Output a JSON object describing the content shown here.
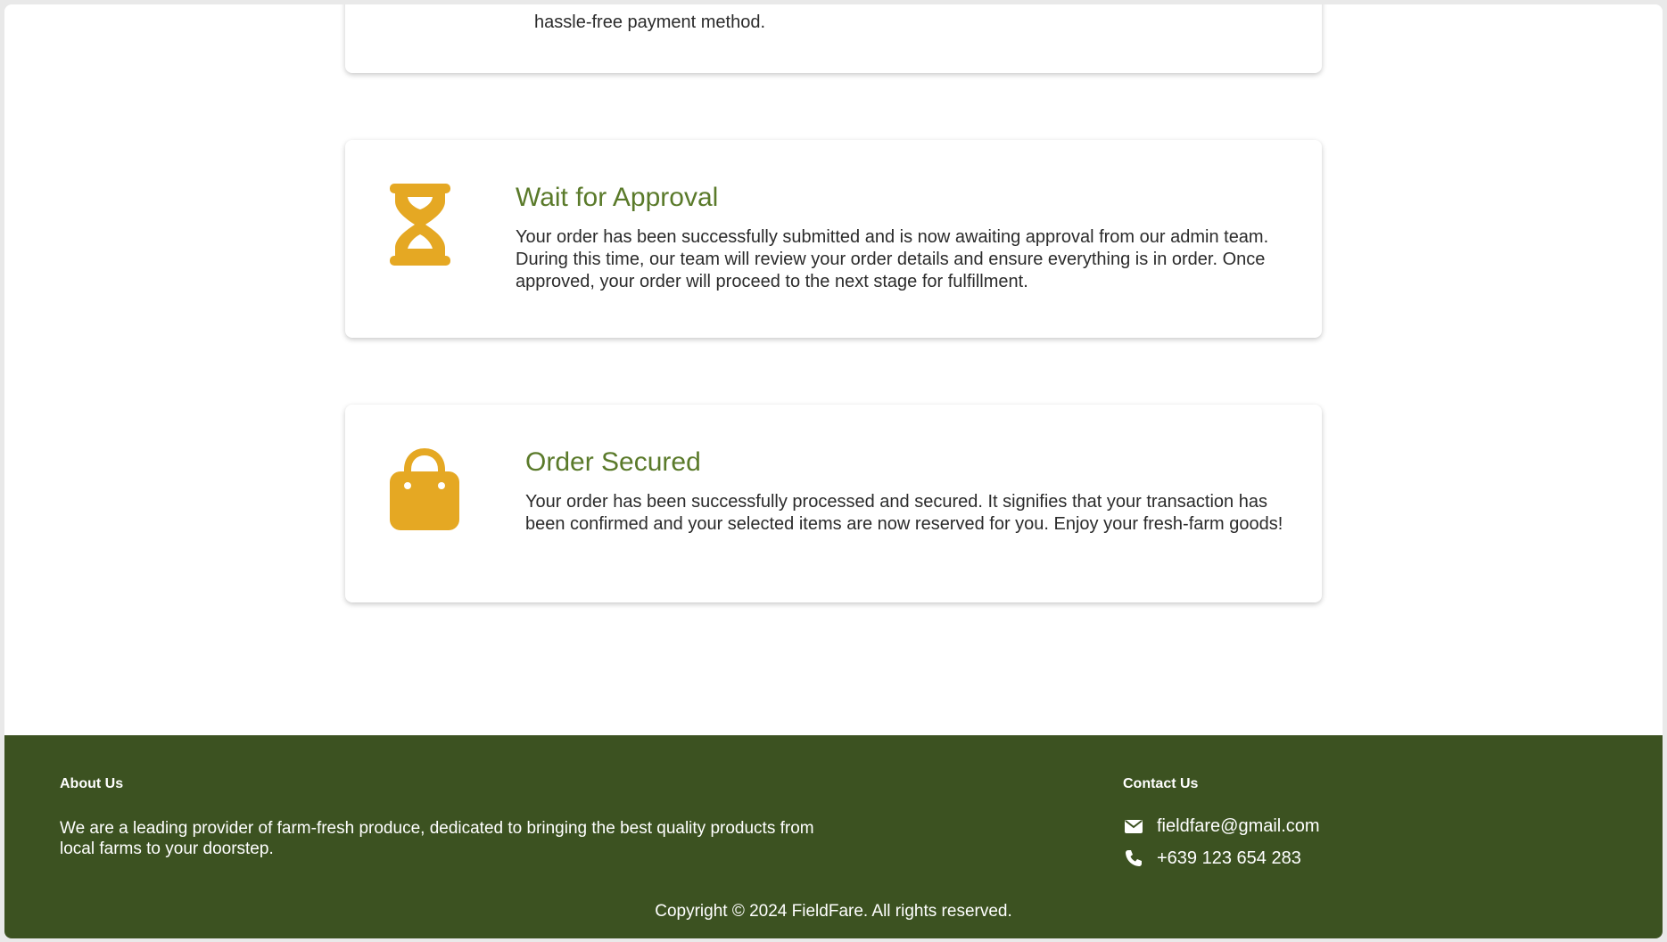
{
  "steps": {
    "partial": {
      "description_tail": "hassle-free payment method."
    },
    "approval": {
      "icon": "hourglass-icon",
      "title": "Wait for Approval",
      "description": "Your order has been successfully submitted and is now awaiting approval from our admin team. During this time, our team will review your order details and ensure everything is in order. Once approved, your order will proceed to the next stage for fulfillment."
    },
    "secured": {
      "icon": "shopping-bag-icon",
      "title": "Order Secured",
      "description": "Your order has been successfully processed and secured. It signifies that your transaction has been confirmed and your selected items are now reserved for you. Enjoy your fresh-farm goods!"
    }
  },
  "footer": {
    "about": {
      "heading": "About Us",
      "text": "We are a leading provider of farm-fresh produce, dedicated to bringing the best quality products from local farms to your doorstep."
    },
    "contact": {
      "heading": "Contact Us",
      "email": "fieldfare@gmail.com",
      "phone": "+639 123 654 283"
    },
    "copyright": "Copyright © 2024 FieldFare. All rights reserved."
  },
  "colors": {
    "accent_icon": "#e5a823",
    "title_green": "#5a7a2a",
    "footer_bg": "#3c5221"
  }
}
